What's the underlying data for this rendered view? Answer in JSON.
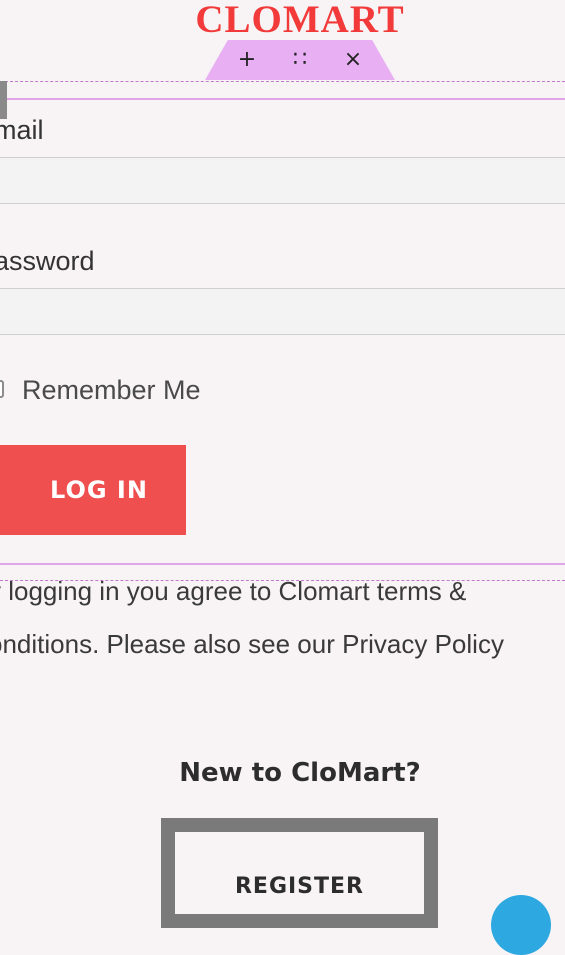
{
  "brand": {
    "name": "CLOMART",
    "color": "#f23a3a"
  },
  "editor_toolbar": {
    "add_glyph": "+",
    "drag_glyph": "∷",
    "close_glyph": "×",
    "color": "#e8b0f2"
  },
  "form": {
    "email_label": "mail",
    "email_value": "",
    "password_label": "assword",
    "password_value": "",
    "remember_label": "Remember Me",
    "remember_checked": false,
    "login_label": "LOG IN",
    "login_color": "#ef4f4f"
  },
  "terms": {
    "line1": "y logging in you agree to Clomart terms &",
    "line2_prefix": "onditions. Please also see our ",
    "privacy_link": "Privacy Policy"
  },
  "register": {
    "prompt": "New to CloMart?",
    "button_label": "REGISTER"
  },
  "help": {
    "icon": "chat-bubble-icon",
    "color": "#2ea8e0"
  }
}
